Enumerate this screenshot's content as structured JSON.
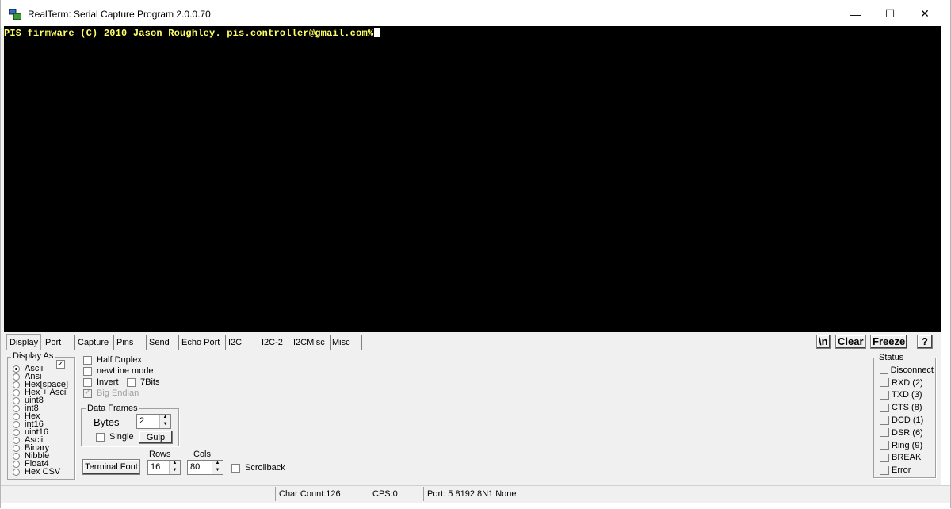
{
  "window": {
    "title": "RealTerm: Serial Capture Program 2.0.0.70",
    "minimize": "—",
    "maximize": "☐",
    "close": "✕"
  },
  "terminal": {
    "text": "PIS firmware (C) 2010 Jason Roughley. pis.controller@gmail.com%",
    "text_color": "#ffff66",
    "background": "#000000"
  },
  "tabs": [
    "Display",
    "Port",
    "Capture",
    "Pins",
    "Send",
    "Echo Port",
    "I2C",
    "I2C-2",
    "I2CMisc",
    "Misc"
  ],
  "active_tab": "Display",
  "top_buttons": {
    "newline": "\\n",
    "clear": "Clear",
    "freeze": "Freeze",
    "help": "?"
  },
  "display_as": {
    "legend": "Display As",
    "options": [
      "Ascii",
      "Ansi",
      "Hex[space]",
      "Hex + Ascii",
      "uint8",
      "int8",
      "Hex",
      "int16",
      "uint16",
      "Ascii",
      "Binary",
      "Nibble",
      "Float4",
      "Hex CSV"
    ],
    "selected": "Ascii",
    "check_mark": "✓"
  },
  "options": {
    "half_duplex": "Half Duplex",
    "newline_mode": "newLine mode",
    "invert": "Invert",
    "seven_bits": "7Bits",
    "big_endian": "Big Endian"
  },
  "data_frames": {
    "legend": "Data Frames",
    "bytes_label": "Bytes",
    "bytes_value": "2",
    "single": "Single",
    "gulp": "Gulp"
  },
  "terminal_font": "Terminal Font",
  "rows": {
    "label": "Rows",
    "value": "16"
  },
  "cols": {
    "label": "Cols",
    "value": "80"
  },
  "scrollback": "Scrollback",
  "status_group": {
    "legend": "Status",
    "items": [
      "Disconnect",
      "RXD (2)",
      "TXD (3)",
      "CTS (8)",
      "DCD (1)",
      "DSR (6)",
      "Ring (9)",
      "BREAK",
      "Error"
    ]
  },
  "statusbar": {
    "char_count": "Char Count:126",
    "cps": "CPS:0",
    "port": "Port: 5 8192 8N1 None"
  }
}
